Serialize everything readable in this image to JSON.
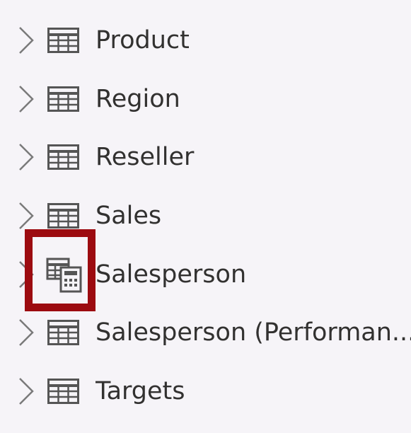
{
  "fields_pane": {
    "tables": [
      {
        "label": "Product",
        "icon": "table-icon"
      },
      {
        "label": "Region",
        "icon": "table-icon"
      },
      {
        "label": "Reseller",
        "icon": "table-icon"
      },
      {
        "label": "Sales",
        "icon": "table-icon"
      },
      {
        "label": "Salesperson",
        "icon": "calculated-table-icon",
        "highlighted": true
      },
      {
        "label": "Salesperson (Performan...",
        "icon": "table-icon"
      },
      {
        "label": "Targets",
        "icon": "table-icon"
      }
    ]
  },
  "colors": {
    "background": "#f6f4f8",
    "text": "#323130",
    "icon": "#555555",
    "highlight": "#9c0b10"
  }
}
